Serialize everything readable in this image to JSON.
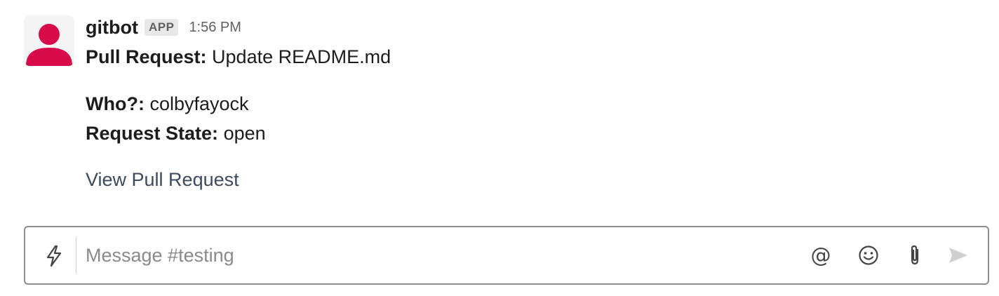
{
  "message": {
    "sender": "gitbot",
    "badge": "APP",
    "timestamp": "1:56 PM",
    "pr_label": "Pull Request:",
    "pr_title": "Update README.md",
    "who_label": "Who?:",
    "who_value": "colbyfayock",
    "state_label": "Request State:",
    "state_value": "open",
    "link_text": "View Pull Request"
  },
  "composer": {
    "placeholder": "Message #testing",
    "icons": [
      "shortcuts-bolt-icon",
      "mention-at-icon",
      "emoji-icon",
      "attach-paperclip-icon",
      "send-icon"
    ]
  },
  "colors": {
    "avatar_accent": "#d70b49",
    "avatar_bg": "#f4f4f4",
    "link": "#3e4a5e"
  }
}
